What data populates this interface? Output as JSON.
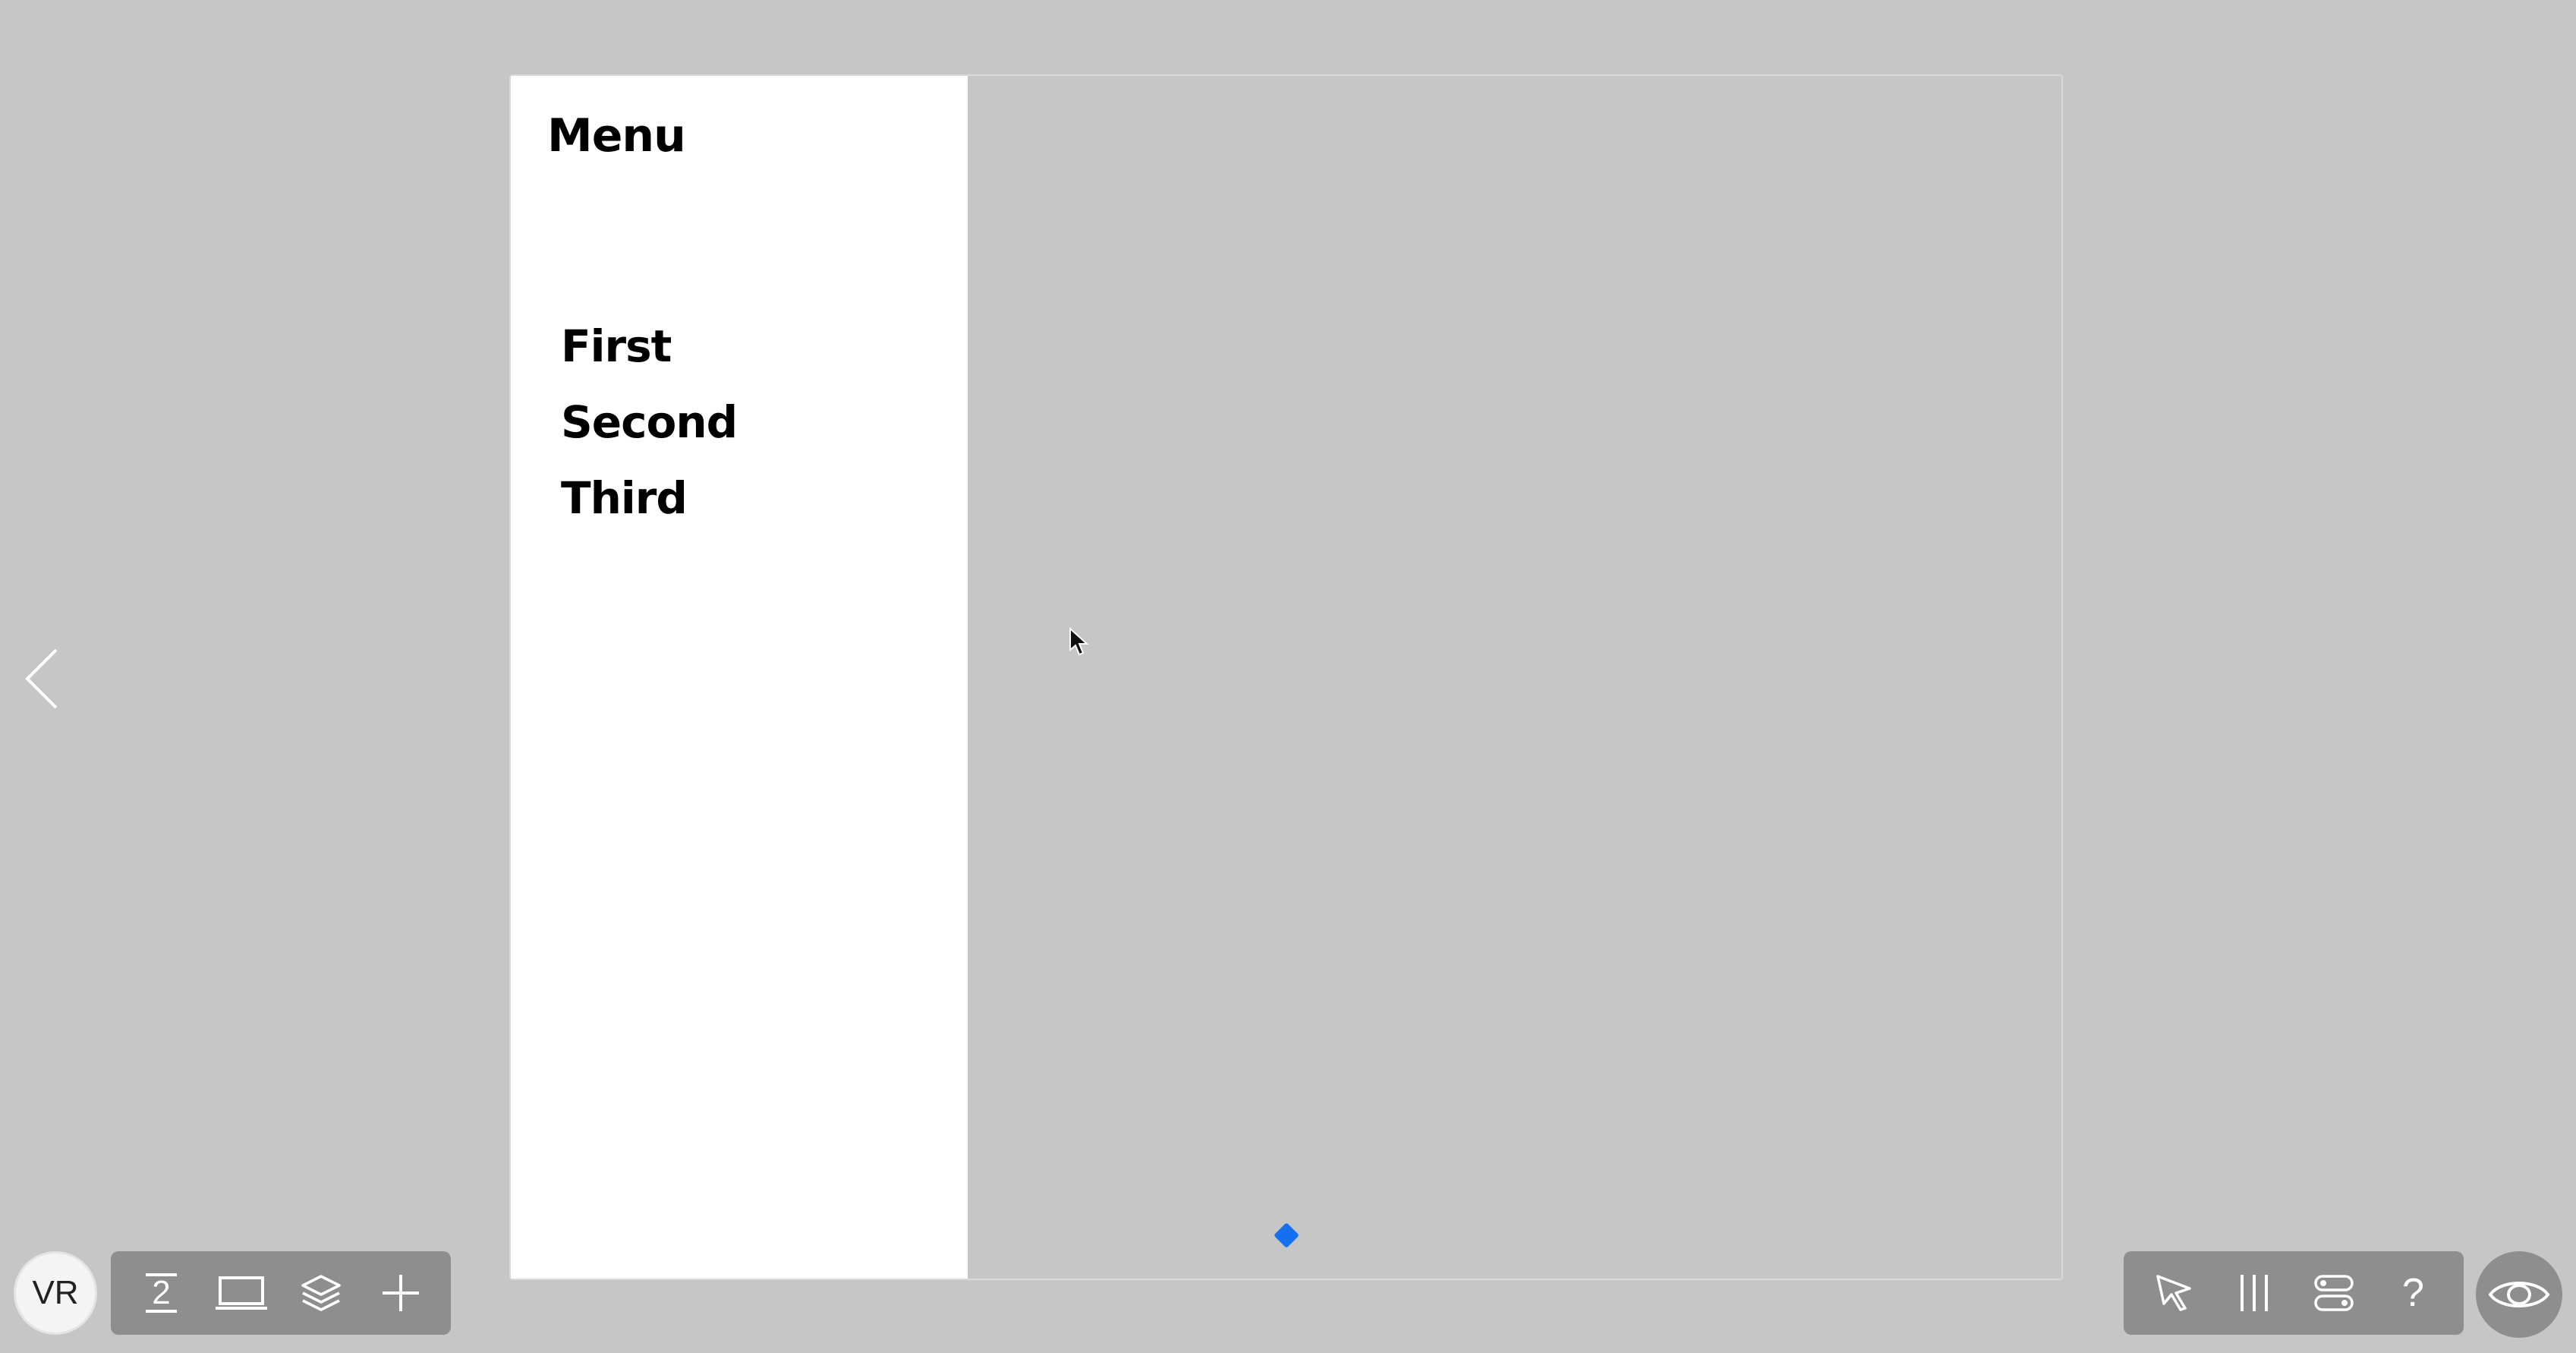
{
  "prototype": {
    "menu_title": "Menu",
    "menu_items": [
      {
        "label": "First"
      },
      {
        "label": "Second"
      },
      {
        "label": "Third"
      }
    ]
  },
  "toolbar_left": {
    "avatar_initials": "VR",
    "page_number": "2",
    "icons": [
      "page-number-icon",
      "device-frame-icon",
      "layers-icon",
      "plus-icon"
    ]
  },
  "toolbar_right": {
    "icons": [
      "pointer-icon",
      "columns-icon",
      "toggles-icon",
      "help-icon"
    ],
    "help_glyph": "?"
  },
  "navigation": {
    "prev_icon": "chevron-left-icon"
  },
  "colors": {
    "background": "#c6c6c6",
    "menu_panel": "#ffffff",
    "toolbar": "#8e8e8e",
    "hotspot": "#1570ef"
  }
}
